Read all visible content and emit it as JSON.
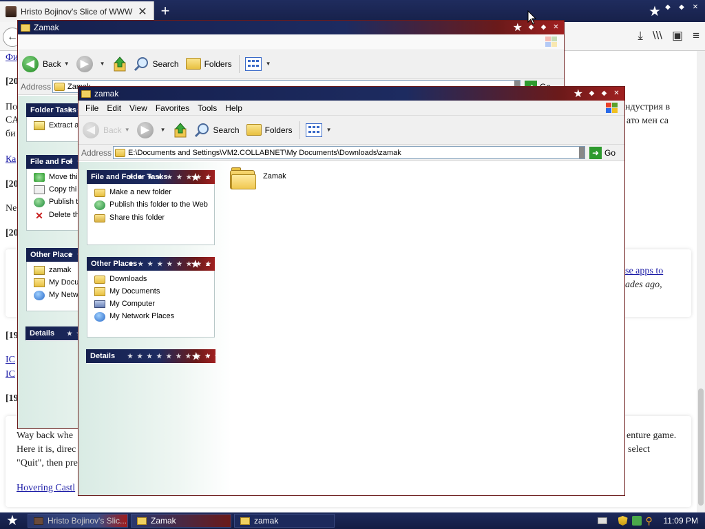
{
  "browser": {
    "tab_title": "Hristo Bojinov's Slice of WWW",
    "tab_close": "✕",
    "new_tab": "+",
    "back": "←",
    "toolbar_icons": [
      "⤓",
      "\\\\\\",
      "▣",
      "≡"
    ],
    "bg_text": {
      "link_fi": "Фи",
      "date1": "[20",
      "line_po": "По",
      "line_ca": "CA",
      "line_bi": "би",
      "right_industry": "ндустрия в",
      "right_men": "ато мен са",
      "link_ka": "Ка",
      "date2": "[20",
      "line_ne": "Ne",
      "date3": "[20",
      "right_apps_link": "se apps to",
      "right_ages": "ades ago,",
      "date4": "[19",
      "link_ic1": "IC",
      "link_ic2": "IC",
      "date5": "[19",
      "way_back": "Way back whe",
      "here_it_is": "Here it is, direc",
      "quit": "\"Quit\", then pre",
      "hovering": "Hovering Castl",
      "right_adventure": "enture game.",
      "right_select": "select"
    }
  },
  "back_window": {
    "title": "Zamak",
    "address_label": "Address",
    "address_value": "Zamak",
    "go": "Go",
    "toolbar": {
      "back": "Back",
      "search": "Search",
      "folders": "Folders"
    },
    "folder_tasks": {
      "header": "Folder Tasks",
      "items": [
        "Extract a"
      ]
    },
    "file_tasks": {
      "header": "File and Fol",
      "items": [
        "Move thi",
        "Copy thi",
        "Publish t",
        "Delete th"
      ]
    },
    "other_places": {
      "header": "Other Place",
      "items": [
        "zamak",
        "My Docu",
        "My Netw"
      ]
    },
    "details": {
      "header": "Details"
    }
  },
  "front_window": {
    "title": "zamak",
    "menu": [
      "File",
      "Edit",
      "View",
      "Favorites",
      "Tools",
      "Help"
    ],
    "toolbar": {
      "back": "Back",
      "search": "Search",
      "folders": "Folders"
    },
    "address_label": "Address",
    "address_value": "E:\\Documents and Settings\\VM2.COLLABNET\\My Documents\\Downloads\\zamak",
    "go": "Go",
    "file_tasks": {
      "header": "File and Folder Tasks",
      "items": [
        "Make a new folder",
        "Publish this folder to the Web",
        "Share this folder"
      ]
    },
    "other_places": {
      "header": "Other Places",
      "items": [
        "Downloads",
        "My Documents",
        "My Computer",
        "My Network Places"
      ]
    },
    "details": {
      "header": "Details"
    },
    "content": {
      "folder_name": "Zamak"
    }
  },
  "taskbar": {
    "tasks": [
      "Hristo Bojinov's Slic...",
      "Zamak",
      "zamak"
    ],
    "clock": "11:09 PM"
  },
  "colors": {
    "title_navy": "#15204e",
    "title_red": "#a02020",
    "xp_bg": "#f0f0f0"
  }
}
